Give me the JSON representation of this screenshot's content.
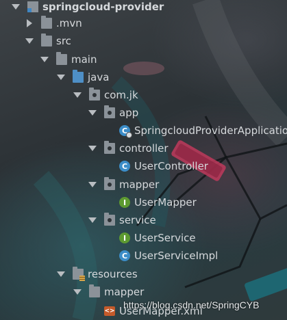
{
  "project_tree": {
    "root": {
      "label": "springcloud-provider",
      "icon": "module-folder-icon"
    },
    "mvn": {
      "label": ".mvn",
      "icon": "folder-icon"
    },
    "src": {
      "label": "src",
      "icon": "folder-icon"
    },
    "main": {
      "label": "main",
      "icon": "folder-icon"
    },
    "java": {
      "label": "java",
      "icon": "source-folder-icon"
    },
    "com_jk": {
      "label": "com.jk",
      "icon": "package-icon"
    },
    "app": {
      "label": "app",
      "icon": "package-icon"
    },
    "app_class": {
      "label": "SpringcloudProviderApplicatio",
      "icon": "spring-boot-class-icon"
    },
    "controller": {
      "label": "controller",
      "icon": "package-icon"
    },
    "user_controller": {
      "label": "UserController",
      "icon": "class-icon"
    },
    "mapper": {
      "label": "mapper",
      "icon": "package-icon"
    },
    "user_mapper": {
      "label": "UserMapper",
      "icon": "interface-icon"
    },
    "service": {
      "label": "service",
      "icon": "package-icon"
    },
    "user_service": {
      "label": "UserService",
      "icon": "interface-icon"
    },
    "user_service_impl": {
      "label": "UserServiceImpl",
      "icon": "class-icon"
    },
    "resources": {
      "label": "resources",
      "icon": "resources-folder-icon"
    },
    "res_mapper": {
      "label": "mapper",
      "icon": "folder-icon"
    },
    "mapper_xml": {
      "label": "UserMapper.xml",
      "icon": "xml-file-icon"
    }
  },
  "icon_glyphs": {
    "class": "C",
    "interface": "I",
    "xml": "<>"
  },
  "watermark": "https://blog.csdn.net/SpringCYB",
  "colors": {
    "class_badge": "#3c8dc8",
    "interface_badge": "#5d9a31",
    "source_folder": "#4e8fc6",
    "xml_badge": "#c45a2a",
    "text": "#d6d9dc"
  }
}
